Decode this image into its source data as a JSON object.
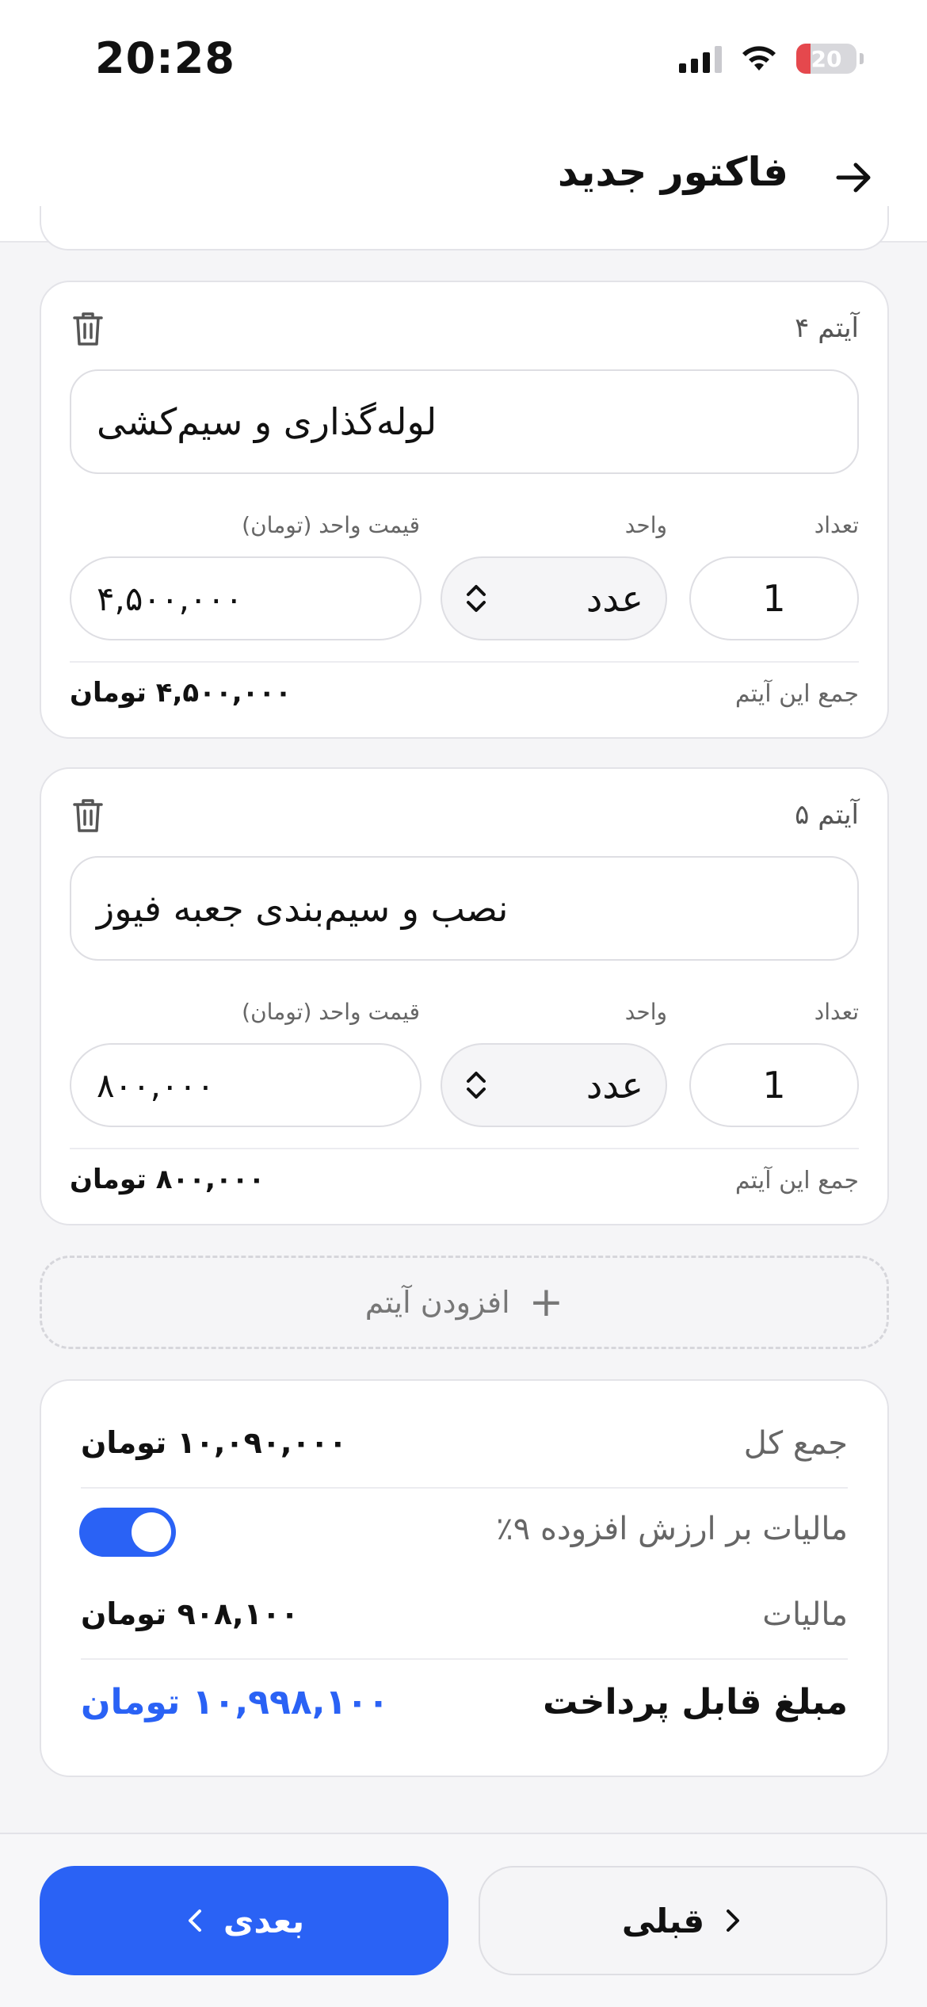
{
  "status_bar": {
    "time": "20:28",
    "battery": "20"
  },
  "header": {
    "title": "فاکتور جدید"
  },
  "items": [
    {
      "title": "آیتم ۴",
      "description": "لوله‌گذاری و سیم‌کشی",
      "qty_label": "تعداد",
      "unit_label": "واحد",
      "price_label": "قیمت واحد (تومان)",
      "qty": "1",
      "unit": "عدد",
      "price": "۴,۵۰۰,۰۰۰",
      "sum_label": "جمع این آیتم",
      "sum_value": "۴,۵۰۰,۰۰۰ تومان"
    },
    {
      "title": "آیتم ۵",
      "description": "نصب و سیم‌بندی جعبه فیوز",
      "qty_label": "تعداد",
      "unit_label": "واحد",
      "price_label": "قیمت واحد (تومان)",
      "qty": "1",
      "unit": "عدد",
      "price": "۸۰۰,۰۰۰",
      "sum_label": "جمع این آیتم",
      "sum_value": "۸۰۰,۰۰۰ تومان"
    }
  ],
  "add_item": {
    "label": "افزودن آیتم"
  },
  "summary": {
    "total_label": "جمع کل",
    "total_value": "۱۰,۰۹۰,۰۰۰ تومان",
    "vat_label": "مالیات بر ارزش افزوده ۹٪",
    "vat_enabled": true,
    "tax_label": "مالیات",
    "tax_value": "۹۰۸,۱۰۰ تومان",
    "payable_label": "مبلغ قابل پرداخت",
    "payable_value": "۱۰,۹۹۸,۱۰۰ تومان"
  },
  "footer": {
    "prev_label": "قبلی",
    "next_label": "بعدی"
  },
  "colors": {
    "accent": "#2a62f5",
    "border": "#e3e3e8",
    "background": "#f5f5f7"
  }
}
